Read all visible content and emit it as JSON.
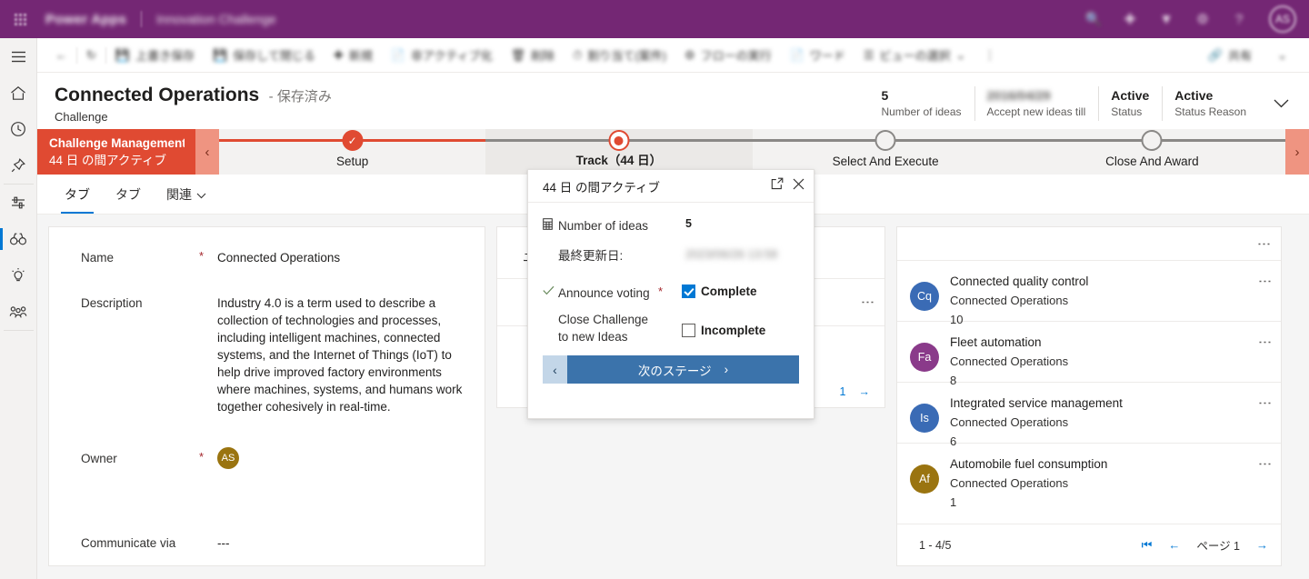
{
  "topbar": {
    "waffle": "app-launcher",
    "brand": "Power Apps",
    "app_name": "Innovation Challenge",
    "icons": [
      "search-icon",
      "plus-icon",
      "filter-icon",
      "gear-icon",
      "help-icon"
    ],
    "avatar_initials": "AS"
  },
  "rail": {
    "items": [
      {
        "name": "hamburger",
        "label": "サイト マップ"
      },
      {
        "name": "home",
        "label": "ホーム"
      },
      {
        "name": "recent",
        "label": "最近使ったもの"
      },
      {
        "name": "pinned",
        "label": "ピン留め"
      },
      {
        "name": "filter",
        "label": "フィルター"
      },
      {
        "name": "challenges",
        "label": "Challenges"
      },
      {
        "name": "ideas",
        "label": "Ideas"
      },
      {
        "name": "groups",
        "label": "Groups"
      }
    ]
  },
  "commandbar": {
    "items": [
      {
        "label": "戻る",
        "icon": "back-arrow-icon"
      },
      {
        "label": "更新",
        "icon": "refresh-icon"
      },
      {
        "label": "上書き保存",
        "icon": "save-icon"
      },
      {
        "label": "保存して閉じる",
        "icon": "save-close-icon"
      },
      {
        "label": "新規",
        "icon": "plus-icon"
      },
      {
        "label": "非アクティブ化",
        "icon": "deactivate-icon"
      },
      {
        "label": "削除",
        "icon": "delete-icon"
      },
      {
        "label": "割り当て(案件)",
        "icon": "assign-icon"
      },
      {
        "label": "フローの実行",
        "icon": "flow-icon"
      },
      {
        "label": "ワード",
        "icon": "word-icon"
      },
      {
        "label": "ビューの選択",
        "icon": "view-icon"
      },
      {
        "label": "その他",
        "icon": "overflow-icon"
      }
    ],
    "right_items": [
      {
        "label": "共有",
        "icon": "share-icon"
      },
      {
        "label": "その他",
        "icon": "chevron-down-icon"
      }
    ]
  },
  "record": {
    "title": "Connected Operations",
    "saved_state": "- 保存済み",
    "entity": "Challenge",
    "header_fields": [
      {
        "value": "5",
        "label": "Number of ideas",
        "blurred": false
      },
      {
        "value": "2016/04/29",
        "label": "Accept new ideas till",
        "blurred": true
      },
      {
        "value": "Active",
        "label": "Status",
        "blurred": false
      },
      {
        "value": "Active",
        "label": "Status Reason",
        "blurred": false
      }
    ],
    "expand_icon": "chevron-down-icon"
  },
  "bpf": {
    "active_title": "Challenge Management ...",
    "active_subtitle": "44 日 の間アクティブ",
    "prev_icon": "chevron-left-icon",
    "next_icon": "chevron-right-icon",
    "stages": [
      {
        "label": "Setup",
        "state": "done"
      },
      {
        "label": "Track（44 日）",
        "state": "current"
      },
      {
        "label": "Select And Execute",
        "state": "future"
      },
      {
        "label": "Close And Award",
        "state": "future"
      }
    ]
  },
  "tabs": [
    {
      "label": "タブ",
      "active": true
    },
    {
      "label": "タブ",
      "active": false
    },
    {
      "label": "関連",
      "active": false,
      "icon": "chevron-down-icon"
    }
  ],
  "form": {
    "fields": [
      {
        "label": "Name",
        "required": true,
        "value": "Connected Operations"
      },
      {
        "label": "Description",
        "required": false,
        "value": "Industry 4.0 is a term used to describe a collection of technologies and processes, including intelligent machines, connected systems, and the Internet of Things (IoT) to help drive improved factory environments where machines, systems, and humans work together cohesively in real-time."
      },
      {
        "label": "Owner",
        "required": true,
        "value": "",
        "avatar_initials": "AS"
      },
      {
        "label": "Communicate via",
        "required": false,
        "value": "---"
      }
    ]
  },
  "middle_card": {
    "title": "ユー",
    "rows": [
      "",
      ""
    ],
    "footer_page": "1",
    "footer_next_icon": "arrow-right-icon"
  },
  "right_card": {
    "kebab_icon": "more-vertical-icon",
    "items": [
      {
        "initials": "Cq",
        "color": "#3a6bb5",
        "title": "Connected quality control",
        "subtitle": "Connected Operations",
        "value": "10"
      },
      {
        "initials": "Fa",
        "color": "#8a3a8a",
        "title": "Fleet automation",
        "subtitle": "Connected Operations",
        "value": "8"
      },
      {
        "initials": "Is",
        "color": "#3a6bb5",
        "title": "Integrated service management",
        "subtitle": "Connected Operations",
        "value": "6"
      },
      {
        "initials": "Af",
        "color": "#9a7410",
        "title": "Automobile fuel consumption",
        "subtitle": "Connected Operations",
        "value": "1"
      }
    ],
    "footer": {
      "count": "1 - 4/5",
      "page_label": "ページ 1",
      "first_icon": "page-first-icon",
      "prev_icon": "arrow-left-icon",
      "next_icon": "arrow-right-icon"
    }
  },
  "flyout": {
    "title": "44 日 の間アクティブ",
    "popout_icon": "open-in-new-window-icon",
    "close_icon": "close-icon",
    "rows": [
      {
        "icon": "number-field-icon",
        "label": "Number of ideas",
        "required": false,
        "value": "5",
        "type": "value"
      },
      {
        "icon": "",
        "label": "最終更新日:",
        "required": false,
        "value": "2023/06/26 13:58",
        "type": "value-blurred"
      },
      {
        "icon": "stage-check-icon",
        "label": "Announce voting",
        "required": true,
        "checkbox_label": "Complete",
        "checked": true,
        "type": "checkbox"
      },
      {
        "icon": "",
        "label": "Close Challenge to new Ideas",
        "required": false,
        "checkbox_label": "Incomplete",
        "checked": false,
        "type": "checkbox"
      }
    ],
    "next_stage_label": "次のステージ",
    "next_icon": "chevron-right-icon",
    "prev_icon": "chevron-left-icon"
  },
  "colors": {
    "brand_purple": "#742774",
    "bpf_active": "#e04a32",
    "accent_blue": "#0078d4",
    "next_button": "#3b73ab"
  }
}
